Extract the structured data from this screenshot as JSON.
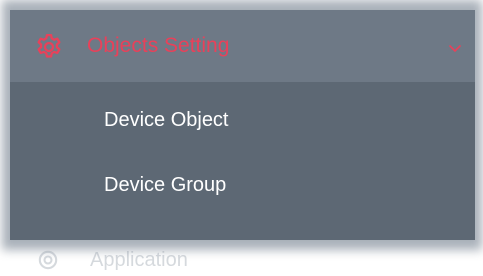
{
  "menu": {
    "header": {
      "icon": "gear-icon",
      "label": "Objects Setting",
      "toggle_icon": "chevron-down-icon",
      "accent_color": "#e8415a"
    },
    "items": [
      {
        "label": "Device Object"
      },
      {
        "label": "Device Group"
      }
    ],
    "next_section": {
      "icon": "gear-icon",
      "label": "Application"
    }
  },
  "colors": {
    "header_bg": "#6e7986",
    "menu_bg": "#5d6874",
    "item_text": "#ffffff"
  }
}
